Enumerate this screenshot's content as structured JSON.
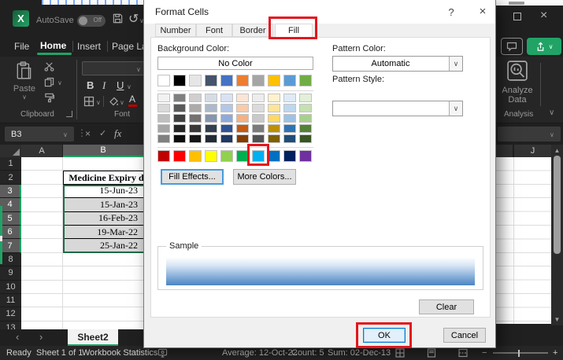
{
  "titlebar": {
    "autosave_label": "AutoSave",
    "autosave_state": "Off"
  },
  "ribbon_tabs": {
    "items": [
      "File",
      "Home",
      "Insert",
      "Page Layout"
    ],
    "active": "Home"
  },
  "ribbon": {
    "paste": "Paste",
    "clipboard_group": "Clipboard",
    "font_group": "Font",
    "bold": "B",
    "italic": "I",
    "underline": "U",
    "font_color": "A",
    "analyze_line1": "Analyze",
    "analyze_line2": "Data",
    "analysis_group": "Analysis"
  },
  "formula_bar": {
    "name_box": "B3",
    "fx": "fx",
    "cancel_glyph": "×",
    "enter_glyph": "✓",
    "dots": "⋮"
  },
  "grid": {
    "columns": [
      "A",
      "B"
    ],
    "right_column": "J",
    "rows": [
      "1",
      "2",
      "3",
      "4",
      "5",
      "6",
      "7",
      "8",
      "9",
      "10",
      "11",
      "12",
      "13"
    ],
    "selected_rows": [
      3,
      4,
      5,
      6,
      7
    ],
    "active_row": 3,
    "table_header": "Medicine Expiry d",
    "dates": [
      "15-Jun-23",
      "15-Jan-23",
      "16-Feb-23",
      "19-Mar-22",
      "25-Jan-22"
    ]
  },
  "dialog": {
    "title": "Format Cells",
    "help_glyph": "?",
    "close_glyph": "×",
    "tabs": [
      "Number",
      "Font",
      "Border",
      "Fill"
    ],
    "active_tab": "Fill",
    "background_color_label": "Background Color:",
    "no_color_button": "No Color",
    "pattern_color_label": "Pattern Color:",
    "pattern_color_value": "Automatic",
    "pattern_style_label": "Pattern Style:",
    "fill_effects_button": "Fill Effects...",
    "more_colors_button": "More Colors...",
    "sample_label": "Sample",
    "clear_button": "Clear",
    "ok_button": "OK",
    "cancel_button": "Cancel",
    "palette": {
      "theme_row": [
        "#FFFFFF",
        "#000000",
        "#E7E6E6",
        "#44546A",
        "#4472C4",
        "#ED7D31",
        "#A5A5A5",
        "#FFC000",
        "#5B9BD5",
        "#70AD47"
      ],
      "tint_rows": [
        [
          "#F2F2F2",
          "#7F7F7F",
          "#D0CECE",
          "#D6DCE4",
          "#D9E2F3",
          "#FBE5D5",
          "#EDEDED",
          "#FFF2CC",
          "#DEEBF6",
          "#E2EFD9"
        ],
        [
          "#D9D9D9",
          "#595959",
          "#AEAAAA",
          "#ACB9CA",
          "#B4C6E7",
          "#F7CBAC",
          "#DBDBDB",
          "#FFE599",
          "#BDD7EE",
          "#C5E0B3"
        ],
        [
          "#BFBFBF",
          "#404040",
          "#767171",
          "#8496B0",
          "#8EAADB",
          "#F4B183",
          "#C9C9C9",
          "#FFD966",
          "#9CC3E5",
          "#A8D08D"
        ],
        [
          "#A6A6A6",
          "#262626",
          "#3A3838",
          "#333F4F",
          "#2F5496",
          "#C55A11",
          "#7B7B7B",
          "#BF8F00",
          "#2E74B5",
          "#538135"
        ],
        [
          "#808080",
          "#0D0D0D",
          "#161616",
          "#222B35",
          "#1F3864",
          "#833C00",
          "#525252",
          "#7F5F00",
          "#1E4E79",
          "#375623"
        ]
      ],
      "standard_row": [
        "#C00000",
        "#FF0000",
        "#FFC000",
        "#FFFF00",
        "#92D050",
        "#00B050",
        "#00B0F0",
        "#0070C0",
        "#002060",
        "#7030A0"
      ],
      "highlighted_standard_index": 6
    }
  },
  "sheet_tabs": {
    "prev_glyph": "‹",
    "next_glyph": "›",
    "active_sheet": "Sheet2"
  },
  "status_bar": {
    "mode": "Ready",
    "sheet_info": "Sheet 1 of 1",
    "workbook_statistics": "Workbook Statistics",
    "average": "Average: 12-Oct-22",
    "count": "Count: 5",
    "sum": "Sum: 02-Dec-13",
    "zoom_minus": "−",
    "zoom_plus": "+"
  },
  "colors": {
    "accent_green": "#21a366",
    "annotation_red": "#e3161d",
    "selection_fill": "#d8d8d8",
    "selection_border": "#1d6b45",
    "sample_gradient_blue": "#4c84c2"
  },
  "glyphs": {
    "chevron_down": "∨",
    "undo": "↺",
    "up_arrow": "▲",
    "down_arrow": "▼"
  }
}
